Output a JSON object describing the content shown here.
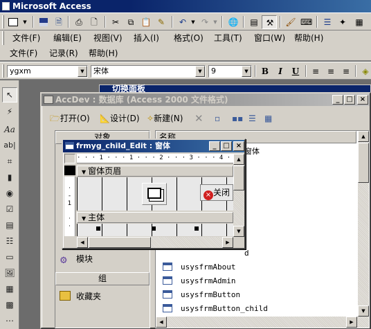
{
  "app": {
    "title": "Microsoft Access"
  },
  "toolbar_icons": [
    "form-view-icon",
    "save-icon",
    "print-icon",
    "print-preview-icon",
    "spelling-icon",
    "cut-icon",
    "copy-icon",
    "paste-icon",
    "format-painter-icon",
    "undo-icon",
    "redo-icon",
    "hyperlink-icon",
    "field-list-icon",
    "toolbox-icon",
    "autoformat-icon",
    "code-icon",
    "properties-icon",
    "build-icon"
  ],
  "menu_primary": [
    "文件(F)",
    "编辑(E)",
    "视图(V)",
    "插入(I)",
    "格式(O)",
    "工具(T)",
    "窗口(W)",
    "帮助(H)"
  ],
  "menu_secondary": [
    "文件(F)",
    "记录(R)",
    "帮助(H)"
  ],
  "format_bar": {
    "object_combo": "ygxm",
    "font_combo": "宋体",
    "size_combo": "9",
    "bold": "B",
    "italic": "I",
    "underline": "U"
  },
  "toolbox_icons": [
    "select-objects-icon",
    "control-wizards-icon",
    "label-icon",
    "textbox-icon",
    "option-group-icon",
    "toggle-button-icon",
    "option-button-icon",
    "checkbox-icon",
    "combo-box-icon",
    "list-box-icon",
    "command-button-icon",
    "image-icon",
    "unbound-object-frame-icon",
    "bound-object-frame-icon",
    "page-break-icon",
    "tab-control-icon"
  ],
  "switchboard": {
    "title": "切换面板"
  },
  "db_window": {
    "title": "AccDev : 数据库 (Access 2000 文件格式)",
    "toolbar": {
      "open": "打开(O)",
      "design": "设计(D)",
      "new": "新建(N)"
    },
    "objects_header": "对象",
    "objects": [
      {
        "label": "模块"
      }
    ],
    "groups_header": "组",
    "groups": [
      {
        "label": "收藏夹"
      }
    ],
    "list_header": "名称",
    "list_items": [
      "usysfrmAbout",
      "usysfrmAdmin",
      "usysfrmButton",
      "usysfrmButton_child"
    ],
    "partial_texts": {
      "selected_suffix": "窗体",
      "item_suffix": "d"
    }
  },
  "form_window": {
    "title": "frmyg_child_Edit : 窗体",
    "ruler": "· · · 1 · · · 1 · · · 2 · · · 3 · · · 4 · · · 5 · · · 1",
    "header_section": "窗体页眉",
    "detail_section": "主体",
    "close_button": "关闭"
  }
}
